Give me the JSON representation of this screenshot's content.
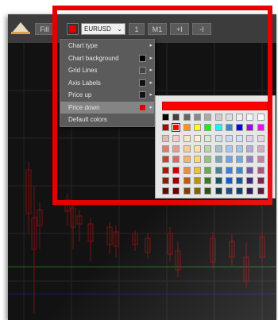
{
  "toolbar": {
    "fill_label": "Fill",
    "symbol": "EURUSD",
    "buttons": [
      "1",
      "M1",
      "+I",
      "-I"
    ]
  },
  "menu": {
    "items": [
      {
        "label": "Chart type",
        "swatch": null,
        "arrow": true
      },
      {
        "label": "Chart background",
        "swatch": "#000000",
        "arrow": true
      },
      {
        "label": "Grid Lines",
        "swatch": "#444444",
        "arrow": true
      },
      {
        "label": "Axis Labels",
        "swatch": "#111111",
        "arrow": true
      },
      {
        "label": "Price up",
        "swatch": "#111111",
        "arrow": true
      },
      {
        "label": "Price down",
        "swatch": "#e00000",
        "arrow": true,
        "active": true
      },
      {
        "label": "Default colors",
        "swatch": null,
        "arrow": false
      }
    ]
  },
  "colors": {
    "selected": "#ff0000",
    "palette_rows": [
      [
        "#000000",
        "#404040",
        "#666666",
        "#888888",
        "#aaaaaa",
        "#cccccc",
        "#dddddd",
        "#eeeeee",
        "#f5f5f5",
        "#ffffff"
      ],
      [
        "#b00000",
        "#ff0000",
        "#ff9900",
        "#ffff00",
        "#00ff00",
        "#00ffff",
        "#3d85c6",
        "#0000ff",
        "#9900ff",
        "#ff00ff"
      ],
      [
        "#e6b8af",
        "#f4cccc",
        "#fce5cd",
        "#fff2cc",
        "#d9ead3",
        "#d0e0e3",
        "#c9daf8",
        "#cfe2f3",
        "#d9d2e9",
        "#ead1dc"
      ],
      [
        "#dd7e6b",
        "#ea9999",
        "#f9cb9c",
        "#ffe599",
        "#b6d7a8",
        "#a2c4c9",
        "#a4c2f4",
        "#9fc5e8",
        "#b4a7d6",
        "#d5a6bd"
      ],
      [
        "#cc4125",
        "#e06666",
        "#f6b26b",
        "#ffd966",
        "#93c47d",
        "#76a5af",
        "#6d9eeb",
        "#6fa8dc",
        "#8e7cc3",
        "#c27ba0"
      ],
      [
        "#a61c00",
        "#cc0000",
        "#e69138",
        "#f1c232",
        "#6aa84f",
        "#45818e",
        "#3c78d8",
        "#3d85c6",
        "#674ea7",
        "#a64d79"
      ],
      [
        "#85200c",
        "#990000",
        "#b45f06",
        "#bf9000",
        "#38761d",
        "#134f5c",
        "#1155cc",
        "#0b5394",
        "#351c75",
        "#741b47"
      ],
      [
        "#5b0f00",
        "#660000",
        "#783f04",
        "#7f6000",
        "#274e13",
        "#0c343d",
        "#1c4587",
        "#073763",
        "#20124d",
        "#4c1130"
      ]
    ]
  }
}
